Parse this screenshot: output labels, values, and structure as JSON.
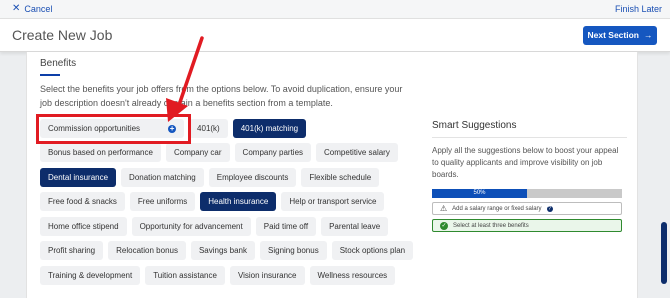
{
  "topbar": {
    "cancel_label": "Cancel",
    "finish_label": "Finish Later"
  },
  "header": {
    "title": "Create New Job",
    "next_label": "Next Section"
  },
  "benefits": {
    "title": "Benefits",
    "intro": "Select the benefits your job offers from the options below. To avoid duplication, ensure your job description doesn't already contain a benefits section from a template.",
    "rows": [
      [
        {
          "label": "Commission opportunities",
          "selected": false,
          "highlight": true
        },
        {
          "label": "401(k)",
          "selected": false
        },
        {
          "label": "401(k) matching",
          "selected": true
        }
      ],
      [
        {
          "label": "Bonus based on performance",
          "selected": false
        },
        {
          "label": "Company car",
          "selected": false
        },
        {
          "label": "Company parties",
          "selected": false
        },
        {
          "label": "Competitive salary",
          "selected": false
        }
      ],
      [
        {
          "label": "Dental insurance",
          "selected": true
        },
        {
          "label": "Donation matching",
          "selected": false
        },
        {
          "label": "Employee discounts",
          "selected": false
        },
        {
          "label": "Flexible schedule",
          "selected": false
        }
      ],
      [
        {
          "label": "Free food & snacks",
          "selected": false
        },
        {
          "label": "Free uniforms",
          "selected": false
        },
        {
          "label": "Health insurance",
          "selected": true
        },
        {
          "label": "Help or transport service",
          "selected": false
        }
      ],
      [
        {
          "label": "Home office stipend",
          "selected": false
        },
        {
          "label": "Opportunity for advancement",
          "selected": false
        },
        {
          "label": "Paid time off",
          "selected": false
        },
        {
          "label": "Parental leave",
          "selected": false
        }
      ],
      [
        {
          "label": "Profit sharing",
          "selected": false
        },
        {
          "label": "Relocation bonus",
          "selected": false
        },
        {
          "label": "Savings bank",
          "selected": false
        },
        {
          "label": "Signing bonus",
          "selected": false
        },
        {
          "label": "Stock options plan",
          "selected": false
        }
      ],
      [
        {
          "label": "Training & development",
          "selected": false
        },
        {
          "label": "Tuition assistance",
          "selected": false
        },
        {
          "label": "Vision insurance",
          "selected": false
        },
        {
          "label": "Wellness resources",
          "selected": false
        }
      ]
    ]
  },
  "smart": {
    "title": "Smart Suggestions",
    "desc": "Apply all the suggestions below to boost your appeal to quality applicants and improve visibility on job boards.",
    "progress_label": "50%",
    "progress_value": 0.5,
    "suggestions": [
      {
        "label": "Add a salary range or fixed salary",
        "done": false
      },
      {
        "label": "Select at least three benefits",
        "done": true
      }
    ]
  },
  "colors": {
    "primary": "#1557c0",
    "selected_chip": "#0d2d6b",
    "highlight": "#e11b22",
    "success": "#2f8a2f"
  },
  "icons": {
    "cancel": "close-icon",
    "next": "arrow-right-icon",
    "add": "plus-circle-icon",
    "warning": "warning-icon",
    "check": "check-circle-icon",
    "help": "help-icon"
  }
}
